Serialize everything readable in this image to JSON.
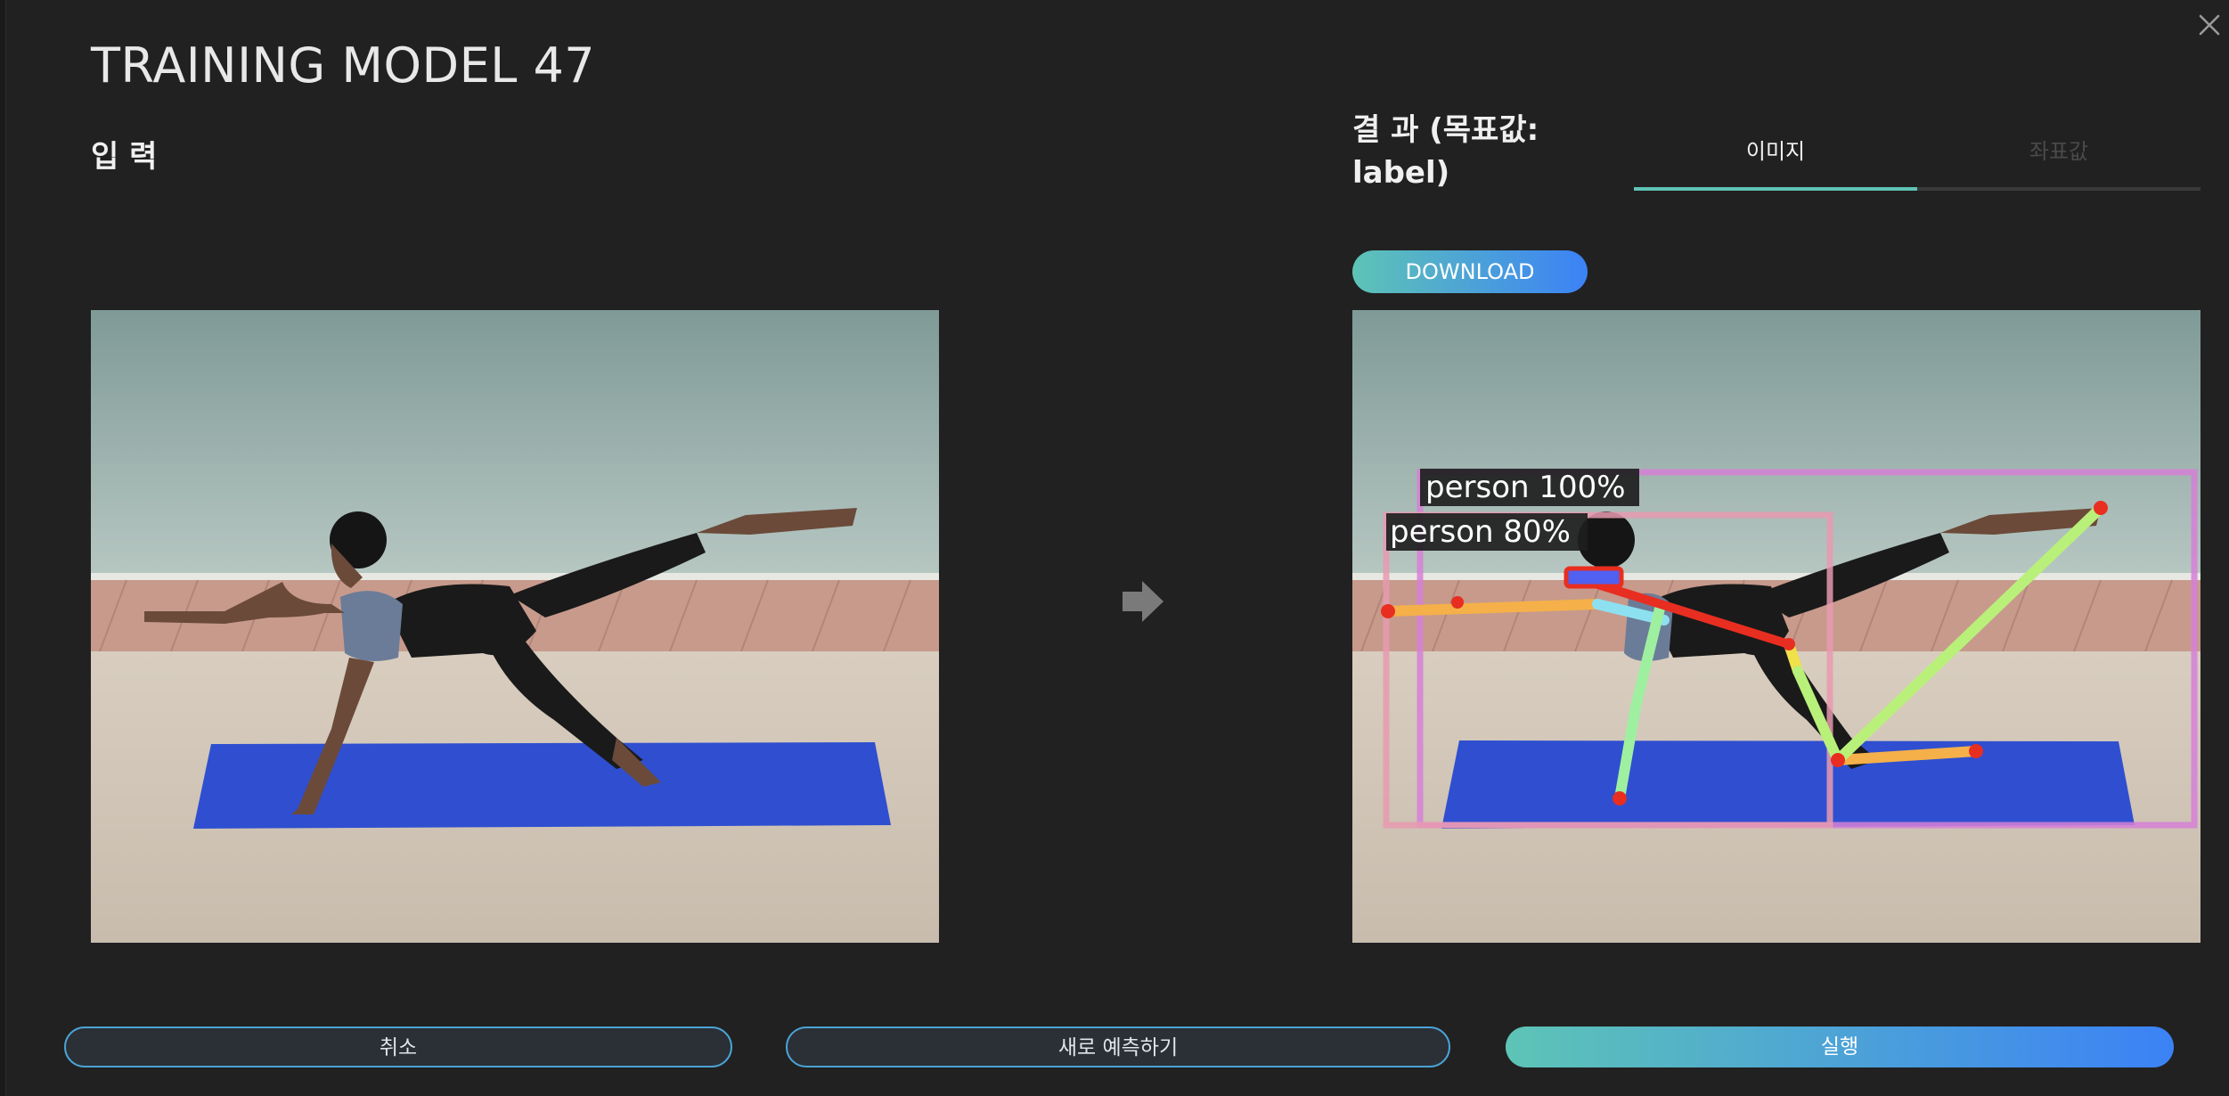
{
  "dialog": {
    "title": "TRAINING MODEL 47",
    "input_label": "입 력",
    "result_label": "결 과 (목표값: label)",
    "tabs": [
      {
        "label": "이미지",
        "active": true
      },
      {
        "label": "좌표값",
        "active": false
      }
    ],
    "download_label": "DOWNLOAD",
    "icons": {
      "close": "close-icon",
      "arrow": "arrow-right-icon"
    }
  },
  "detections": [
    {
      "label": "person 100%",
      "box_color": "#d680d6"
    },
    {
      "label": "person 80%",
      "box_color": "#e89ab0"
    }
  ],
  "footer": {
    "cancel_label": "취소",
    "new_predict_label": "새로 예측하기",
    "run_label": "실행"
  },
  "colors": {
    "background": "#212121",
    "accent_start": "#5ec4b6",
    "accent_end": "#3b82f6",
    "outline": "#4aa3d6"
  }
}
